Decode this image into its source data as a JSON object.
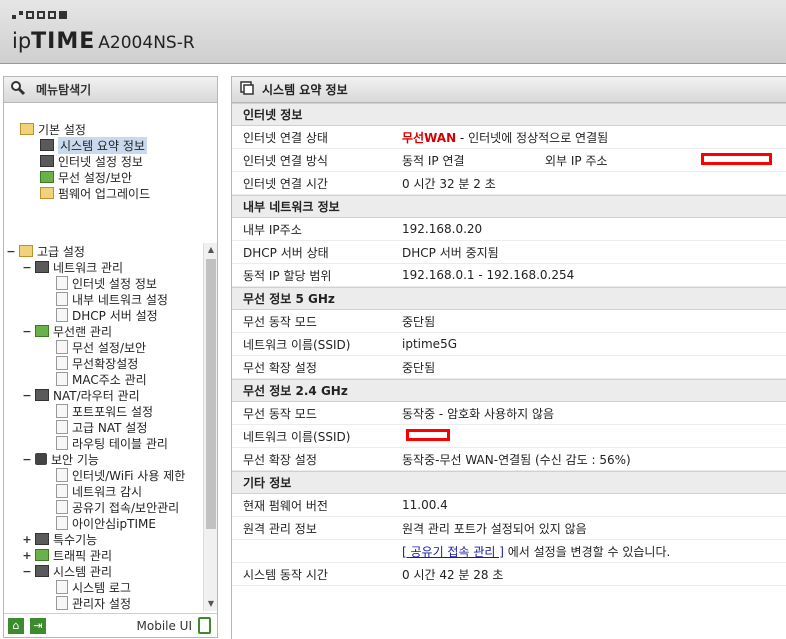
{
  "header": {
    "brand_ip": "ip",
    "brand_time": "TIME",
    "model": "A2004NS-R"
  },
  "left": {
    "title": "메뉴탐색기",
    "basic": {
      "label": "기본 설정",
      "items": [
        "시스템 요약 정보",
        "인터넷 설정 정보",
        "무선 설정/보안",
        "펌웨어 업그레이드"
      ]
    },
    "advanced": {
      "label": "고급 설정",
      "network": {
        "label": "네트워크 관리",
        "items": [
          "인터넷 설정 정보",
          "내부 네트워크 설정",
          "DHCP 서버 설정"
        ]
      },
      "wireless": {
        "label": "무선랜 관리",
        "items": [
          "무선 설정/보안",
          "무선확장설정",
          "MAC주소 관리"
        ]
      },
      "nat": {
        "label": "NAT/라우터 관리",
        "items": [
          "포트포워드 설정",
          "고급 NAT 설정",
          "라우팅 테이블 관리"
        ]
      },
      "security": {
        "label": "보안 기능",
        "items": [
          "인터넷/WiFi 사용 제한",
          "네트워크 감시",
          "공유기 접속/보안관리",
          "아이안심ipTIME"
        ]
      },
      "special": "특수기능",
      "traffic": "트래픽 관리",
      "system": {
        "label": "시스템 관리",
        "items": [
          "시스템 로그",
          "관리자 설정"
        ]
      }
    },
    "footer": {
      "mobile_label": "Mobile UI"
    }
  },
  "right": {
    "title": "시스템 요약 정보",
    "internet": {
      "title": "인터넷 정보",
      "status_label": "인터넷 연결 상태",
      "status_red": "무선WAN",
      "status_rest": " - 인터넷에 정상적으로 연결됨",
      "method_label": "인터넷 연결 방식",
      "method_value": "동적 IP 연결",
      "ext_ip_label": "외부 IP 주소",
      "time_label": "인터넷 연결 시간",
      "time_value": "0 시간 32 분 2 초"
    },
    "lan": {
      "title": "내부 네트워크 정보",
      "ip_label": "내부 IP주소",
      "ip_value": "192.168.0.20",
      "dhcp_label": "DHCP 서버 상태",
      "dhcp_value": "DHCP 서버 중지됨",
      "range_label": "동적 IP 할당 범위",
      "range_value": "192.168.0.1 -  192.168.0.254"
    },
    "w5": {
      "title": "무선 정보 5 GHz",
      "mode_label": "무선 동작 모드",
      "mode_value": "중단됨",
      "ssid_label": "네트워크 이름(SSID)",
      "ssid_value": "iptime5G",
      "ext_label": "무선 확장 설정",
      "ext_value": "중단됨"
    },
    "w24": {
      "title": "무선 정보 2.4 GHz",
      "mode_label": "무선 동작 모드",
      "mode_value": "동작중 - 암호화 사용하지 않음",
      "ssid_label": "네트워크 이름(SSID)",
      "ext_label": "무선 확장 설정",
      "ext_value": "동작중-무선 WAN-연결됨 (수신 감도 : 56%)"
    },
    "etc": {
      "title": "기타 정보",
      "fw_label": "현재 펌웨어 버전",
      "fw_value": "11.00.4",
      "remote_label": "원격 관리 정보",
      "remote_value": "원격 관리 포트가 설정되어 있지 않음",
      "remote_link": "[ 공유기 접속 관리 ]",
      "remote_link_suffix": " 에서 설정을 변경할 수 있습니다.",
      "uptime_label": "시스템 동작 시간",
      "uptime_value": "0 시간 42 분 28 초"
    }
  }
}
